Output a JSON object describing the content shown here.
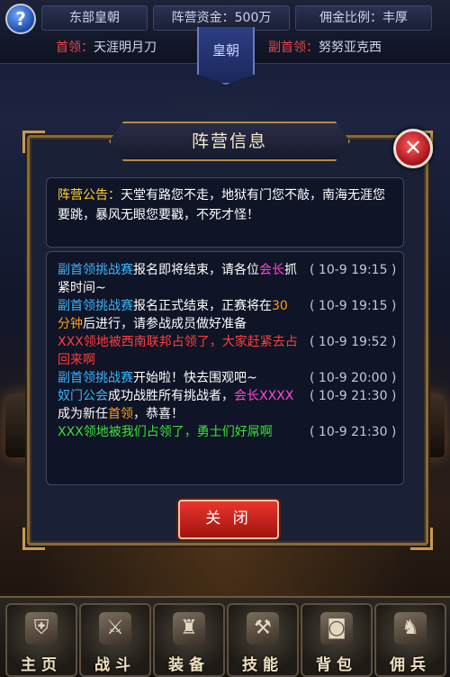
{
  "topbar": {
    "help_label": "?",
    "faction": "东部皇朝",
    "funds": "阵营资金：500万",
    "commission": "佣金比例：丰厚",
    "leader_label": "首领：",
    "leader_name": "天涯明月刀",
    "deputy_label": "副首领：",
    "deputy_name": "努努亚克西",
    "banner_text": "皇朝"
  },
  "dialog": {
    "title": "阵营信息",
    "close_icon_glyph": "✕",
    "notice": {
      "tag": "阵营公告：",
      "text": "天堂有路您不走，地狱有门您不敲，南海无涯您要跳，暴风无眼您要戳，不死才怪！"
    },
    "log": [
      {
        "parts": [
          {
            "t": "副首领挑战赛",
            "c": "blue"
          },
          {
            "t": "报名即将结束，请各位",
            "c": "white"
          },
          {
            "t": "会长",
            "c": "mag"
          },
          {
            "t": "抓紧时间~",
            "c": "white"
          }
        ],
        "time": "( 10-9 19:15 )"
      },
      {
        "parts": [
          {
            "t": "副首领挑战赛",
            "c": "blue"
          },
          {
            "t": "报名正式结束，正赛将在",
            "c": "white"
          },
          {
            "t": "30分钟",
            "c": "orange"
          },
          {
            "t": "后进行，请参战成员做好准备",
            "c": "white"
          }
        ],
        "time": "( 10-9 19:15 )"
      },
      {
        "parts": [
          {
            "t": "XXX领地被西南联邦占领了，大家赶紧去占回来啊",
            "c": "red"
          }
        ],
        "time": "( 10-9 19:52 )"
      },
      {
        "parts": [
          {
            "t": "副首领挑战赛",
            "c": "blue"
          },
          {
            "t": "开始啦！快去围观吧~",
            "c": "white"
          }
        ],
        "time": "( 10-9 20:00 )"
      },
      {
        "parts": [
          {
            "t": "奴门公会",
            "c": "blue"
          },
          {
            "t": "成功战胜所有挑战者，",
            "c": "white"
          },
          {
            "t": "会长XXXX",
            "c": "mag"
          },
          {
            "t": "成为新任",
            "c": "white"
          },
          {
            "t": "首领",
            "c": "orange"
          },
          {
            "t": "，恭喜！",
            "c": "white"
          }
        ],
        "time": "( 10-9 21:30 )"
      },
      {
        "parts": [
          {
            "t": "XXX领地被我们占领了，勇士们好屌啊",
            "c": "green"
          }
        ],
        "time": "( 10-9 21:30 )"
      }
    ],
    "close_button": "关 闭"
  },
  "bottom_nav": [
    {
      "label": "主页",
      "icon": "armor-icon",
      "glyph": "⛨"
    },
    {
      "label": "战斗",
      "icon": "swords-icon",
      "glyph": "⚔"
    },
    {
      "label": "装备",
      "icon": "chestplate-icon",
      "glyph": "♜"
    },
    {
      "label": "技能",
      "icon": "hammer-icon",
      "glyph": "⚒"
    },
    {
      "label": "背包",
      "icon": "bag-icon",
      "glyph": "◙"
    },
    {
      "label": "佣兵",
      "icon": "mercenary-icon",
      "glyph": "♞"
    }
  ],
  "colors": {
    "blue": "#3ab7ff",
    "white": "#ffffff",
    "red": "#ff3e3e",
    "mag": "#ff47d6",
    "orange": "#ff9d1a",
    "green": "#39e23a",
    "tag_yellow": "#ffd23a",
    "button_red": "#d8251e",
    "frame_gold": "#b48a48"
  }
}
